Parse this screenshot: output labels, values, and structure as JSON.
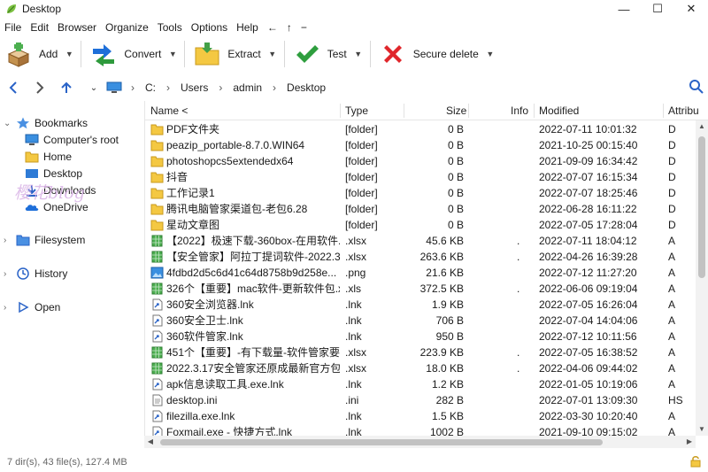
{
  "window": {
    "title": "Desktop",
    "minimize": "—",
    "maximize": "☐",
    "close": "✕"
  },
  "menu": [
    "File",
    "Edit",
    "Browser",
    "Organize",
    "Tools",
    "Options",
    "Help",
    "←",
    "↑",
    "−"
  ],
  "toolbar": {
    "add": "Add",
    "convert": "Convert",
    "extract": "Extract",
    "test": "Test",
    "secure_delete": "Secure delete"
  },
  "address": {
    "drive": "C:",
    "path": [
      "Users",
      "admin",
      "Desktop"
    ]
  },
  "tree": {
    "bookmarks": "Bookmarks",
    "items": [
      "Computer's root",
      "Home",
      "Desktop",
      "Downloads",
      "OneDrive"
    ],
    "filesystem": "Filesystem",
    "history": "History",
    "open": "Open"
  },
  "watermark": "樱花blog",
  "columns": {
    "name": "Name <",
    "type": "Type",
    "size": "Size",
    "info": "Info",
    "modified": "Modified",
    "attributes": "Attribu"
  },
  "files": [
    {
      "icon": "folder",
      "name": "PDF文件夹",
      "type": "[folder]",
      "size": "0 B",
      "info": "",
      "modified": "2022-07-11 10:01:32",
      "attr": "D"
    },
    {
      "icon": "folder",
      "name": "peazip_portable-8.7.0.WIN64",
      "type": "[folder]",
      "size": "0 B",
      "info": "",
      "modified": "2021-10-25 00:15:40",
      "attr": "D"
    },
    {
      "icon": "folder",
      "name": "photoshopcs5extendedx64",
      "type": "[folder]",
      "size": "0 B",
      "info": "",
      "modified": "2021-09-09 16:34:42",
      "attr": "D"
    },
    {
      "icon": "folder",
      "name": "抖音",
      "type": "[folder]",
      "size": "0 B",
      "info": "",
      "modified": "2022-07-07 16:15:34",
      "attr": "D"
    },
    {
      "icon": "folder",
      "name": "工作记录1",
      "type": "[folder]",
      "size": "0 B",
      "info": "",
      "modified": "2022-07-07 18:25:46",
      "attr": "D"
    },
    {
      "icon": "folder",
      "name": "腾讯电脑管家渠道包-老包6.28",
      "type": "[folder]",
      "size": "0 B",
      "info": "",
      "modified": "2022-06-28 16:11:22",
      "attr": "D"
    },
    {
      "icon": "folder",
      "name": "星动文章图",
      "type": "[folder]",
      "size": "0 B",
      "info": "",
      "modified": "2022-07-05 17:28:04",
      "attr": "D"
    },
    {
      "icon": "xlsx",
      "name": "【2022】极速下载-360box-在用软件...",
      "type": ".xlsx",
      "size": "45.6 KB",
      "info": ".",
      "modified": "2022-07-11 18:04:12",
      "attr": "A"
    },
    {
      "icon": "xlsx",
      "name": "【安全管家】阿拉丁提词软件-2022.3....",
      "type": ".xlsx",
      "size": "263.6 KB",
      "info": ".",
      "modified": "2022-04-26 16:39:28",
      "attr": "A"
    },
    {
      "icon": "png",
      "name": "4fdbd2d5c6d41c64d8758b9d258e...",
      "type": ".png",
      "size": "21.6 KB",
      "info": "",
      "modified": "2022-07-12 11:27:20",
      "attr": "A"
    },
    {
      "icon": "xlsx",
      "name": "326个【重要】mac软件-更新软件包.xls",
      "type": ".xls",
      "size": "372.5 KB",
      "info": ".",
      "modified": "2022-06-06 09:19:04",
      "attr": "A"
    },
    {
      "icon": "lnk",
      "name": "360安全浏览器.lnk",
      "type": ".lnk",
      "size": "1.9 KB",
      "info": "",
      "modified": "2022-07-05 16:26:04",
      "attr": "A"
    },
    {
      "icon": "lnk",
      "name": "360安全卫士.lnk",
      "type": ".lnk",
      "size": "706 B",
      "info": "",
      "modified": "2022-07-04 14:04:06",
      "attr": "A"
    },
    {
      "icon": "lnk",
      "name": "360软件管家.lnk",
      "type": ".lnk",
      "size": "950 B",
      "info": "",
      "modified": "2022-07-12 10:11:56",
      "attr": "A"
    },
    {
      "icon": "xlsx",
      "name": "451个【重要】-有下载量-软件管家要...",
      "type": ".xlsx",
      "size": "223.9 KB",
      "info": ".",
      "modified": "2022-07-05 16:38:52",
      "attr": "A"
    },
    {
      "icon": "xlsx",
      "name": "2022.3.17安全管家还原成最新官方包...",
      "type": ".xlsx",
      "size": "18.0 KB",
      "info": ".",
      "modified": "2022-04-06 09:44:02",
      "attr": "A"
    },
    {
      "icon": "lnk",
      "name": "apk信息读取工具.exe.lnk",
      "type": ".lnk",
      "size": "1.2 KB",
      "info": "",
      "modified": "2022-01-05 10:19:06",
      "attr": "A"
    },
    {
      "icon": "ini",
      "name": "desktop.ini",
      "type": ".ini",
      "size": "282 B",
      "info": "",
      "modified": "2022-07-01 13:09:30",
      "attr": "HS"
    },
    {
      "icon": "lnk",
      "name": "filezilla.exe.lnk",
      "type": ".lnk",
      "size": "1.5 KB",
      "info": "",
      "modified": "2022-03-30 10:20:40",
      "attr": "A"
    },
    {
      "icon": "lnk",
      "name": "Foxmail.exe - 快捷方式.lnk",
      "type": ".lnk",
      "size": "1002 B",
      "info": "",
      "modified": "2021-09-10 09:15:02",
      "attr": "A"
    }
  ],
  "status": "7 dir(s), 43 file(s), 127.4 MB"
}
